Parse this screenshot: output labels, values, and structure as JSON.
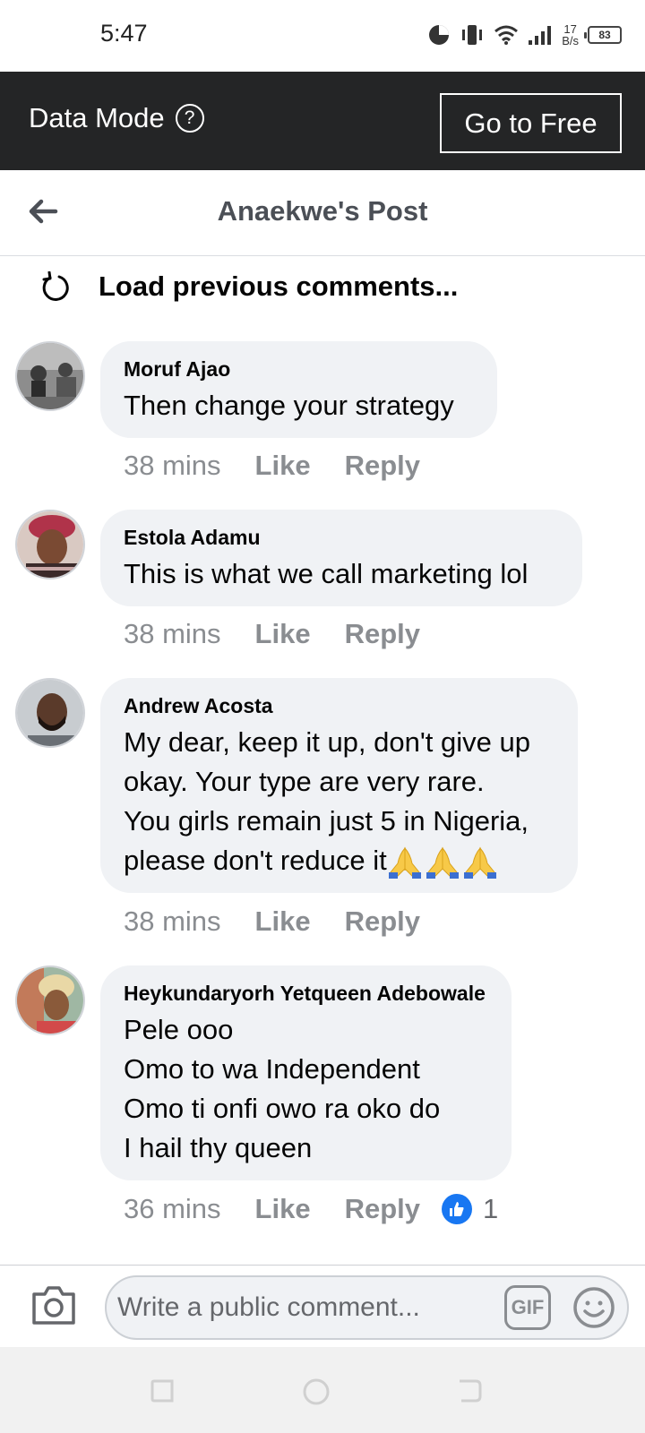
{
  "status_bar": {
    "time": "5:47",
    "net_speed_value": "17",
    "net_speed_unit": "B/s",
    "battery": "83"
  },
  "data_mode": {
    "label": "Data Mode",
    "help": "?",
    "button": "Go to Free"
  },
  "header": {
    "title": "Anaekwe's Post"
  },
  "load_previous": {
    "label": "Load previous comments..."
  },
  "comments": [
    {
      "author": "Moruf Ajao",
      "lines": [
        "Then change your strategy"
      ],
      "time": "38 mins",
      "like": "Like",
      "reply": "Reply"
    },
    {
      "author": "Estola Adamu",
      "lines": [
        "This is what we call marketing lol"
      ],
      "time": "38 mins",
      "like": "Like",
      "reply": "Reply"
    },
    {
      "author": "Andrew Acosta",
      "lines": [
        "My dear, keep it up, don't give up",
        "okay. Your type are very rare.",
        "You girls remain just 5 in Nigeria,",
        "please don't reduce it"
      ],
      "time": "38 mins",
      "like": "Like",
      "reply": "Reply"
    },
    {
      "author": "Heykundaryorh Yetqueen Adebowale",
      "lines": [
        "Pele ooo",
        "Omo to wa Independent",
        "Omo ti onfi owo ra oko do",
        "I hail thy queen"
      ],
      "time": "36 mins",
      "like": "Like",
      "reply": "Reply",
      "reaction_count": "1"
    }
  ],
  "composer": {
    "placeholder": "Write a public comment...",
    "gif": "GIF"
  },
  "colors": {
    "data_bar": "#242526",
    "bubble": "#f0f2f5",
    "meta_text": "#8a8d91",
    "like_blue": "#1877f2"
  }
}
